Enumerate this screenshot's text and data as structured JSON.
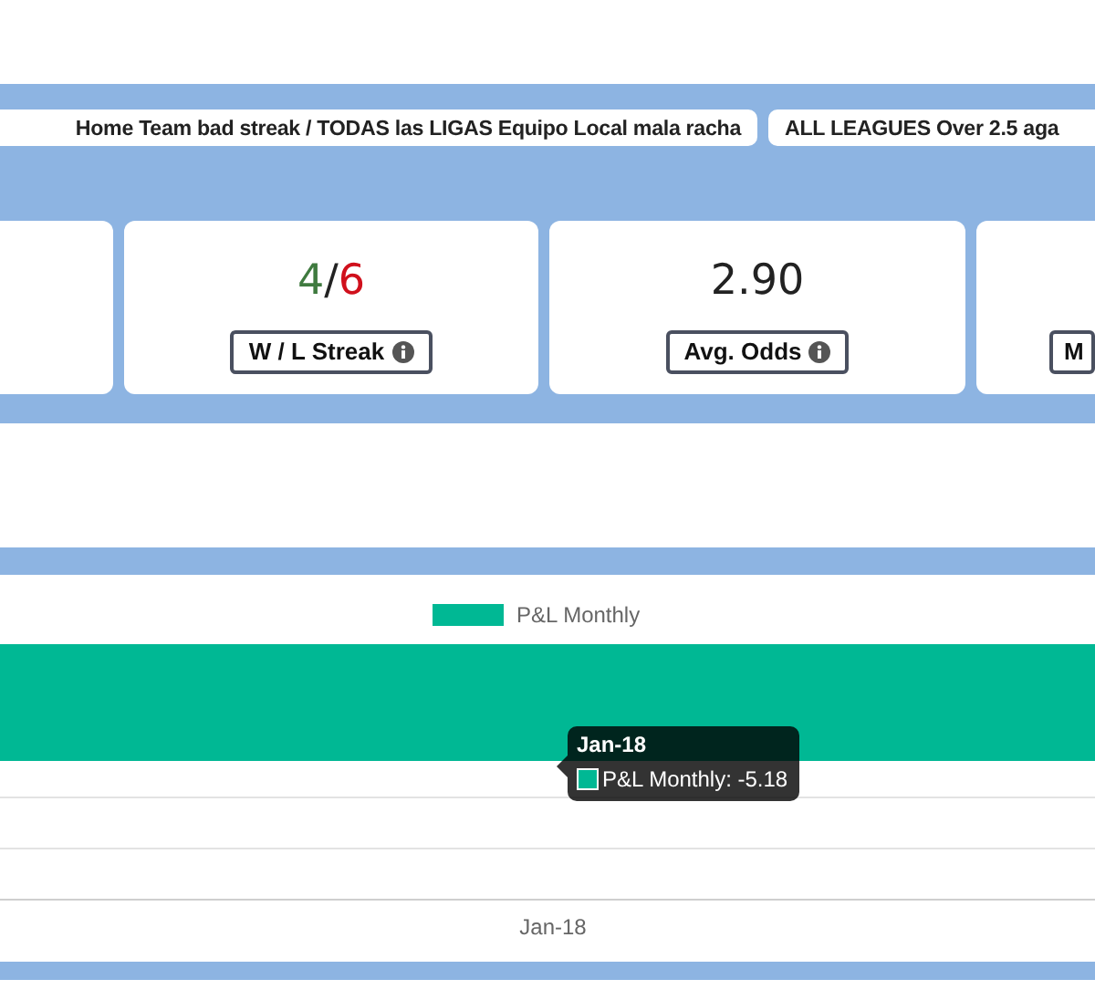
{
  "filter_tabs": [
    {
      "label": "Home Team bad streak / TODAS las LIGAS Equipo Local mala racha"
    },
    {
      "label": "ALL LEAGUES Over 2.5 aga"
    }
  ],
  "stat_cards": [
    {
      "kind": "blank"
    },
    {
      "kind": "streak",
      "wins": "4",
      "separator": "/",
      "losses": "6",
      "label": "W / L Streak",
      "info_icon": true
    },
    {
      "kind": "value",
      "value": "2.90",
      "label": "Avg. Odds",
      "info_icon": true
    },
    {
      "kind": "cut",
      "label": "M"
    }
  ],
  "chart": {
    "legend": "P&L Monthly",
    "x_label": "Jan-18",
    "tooltip": {
      "title": "Jan-18",
      "text": "P&L Monthly: -5.18"
    }
  }
}
